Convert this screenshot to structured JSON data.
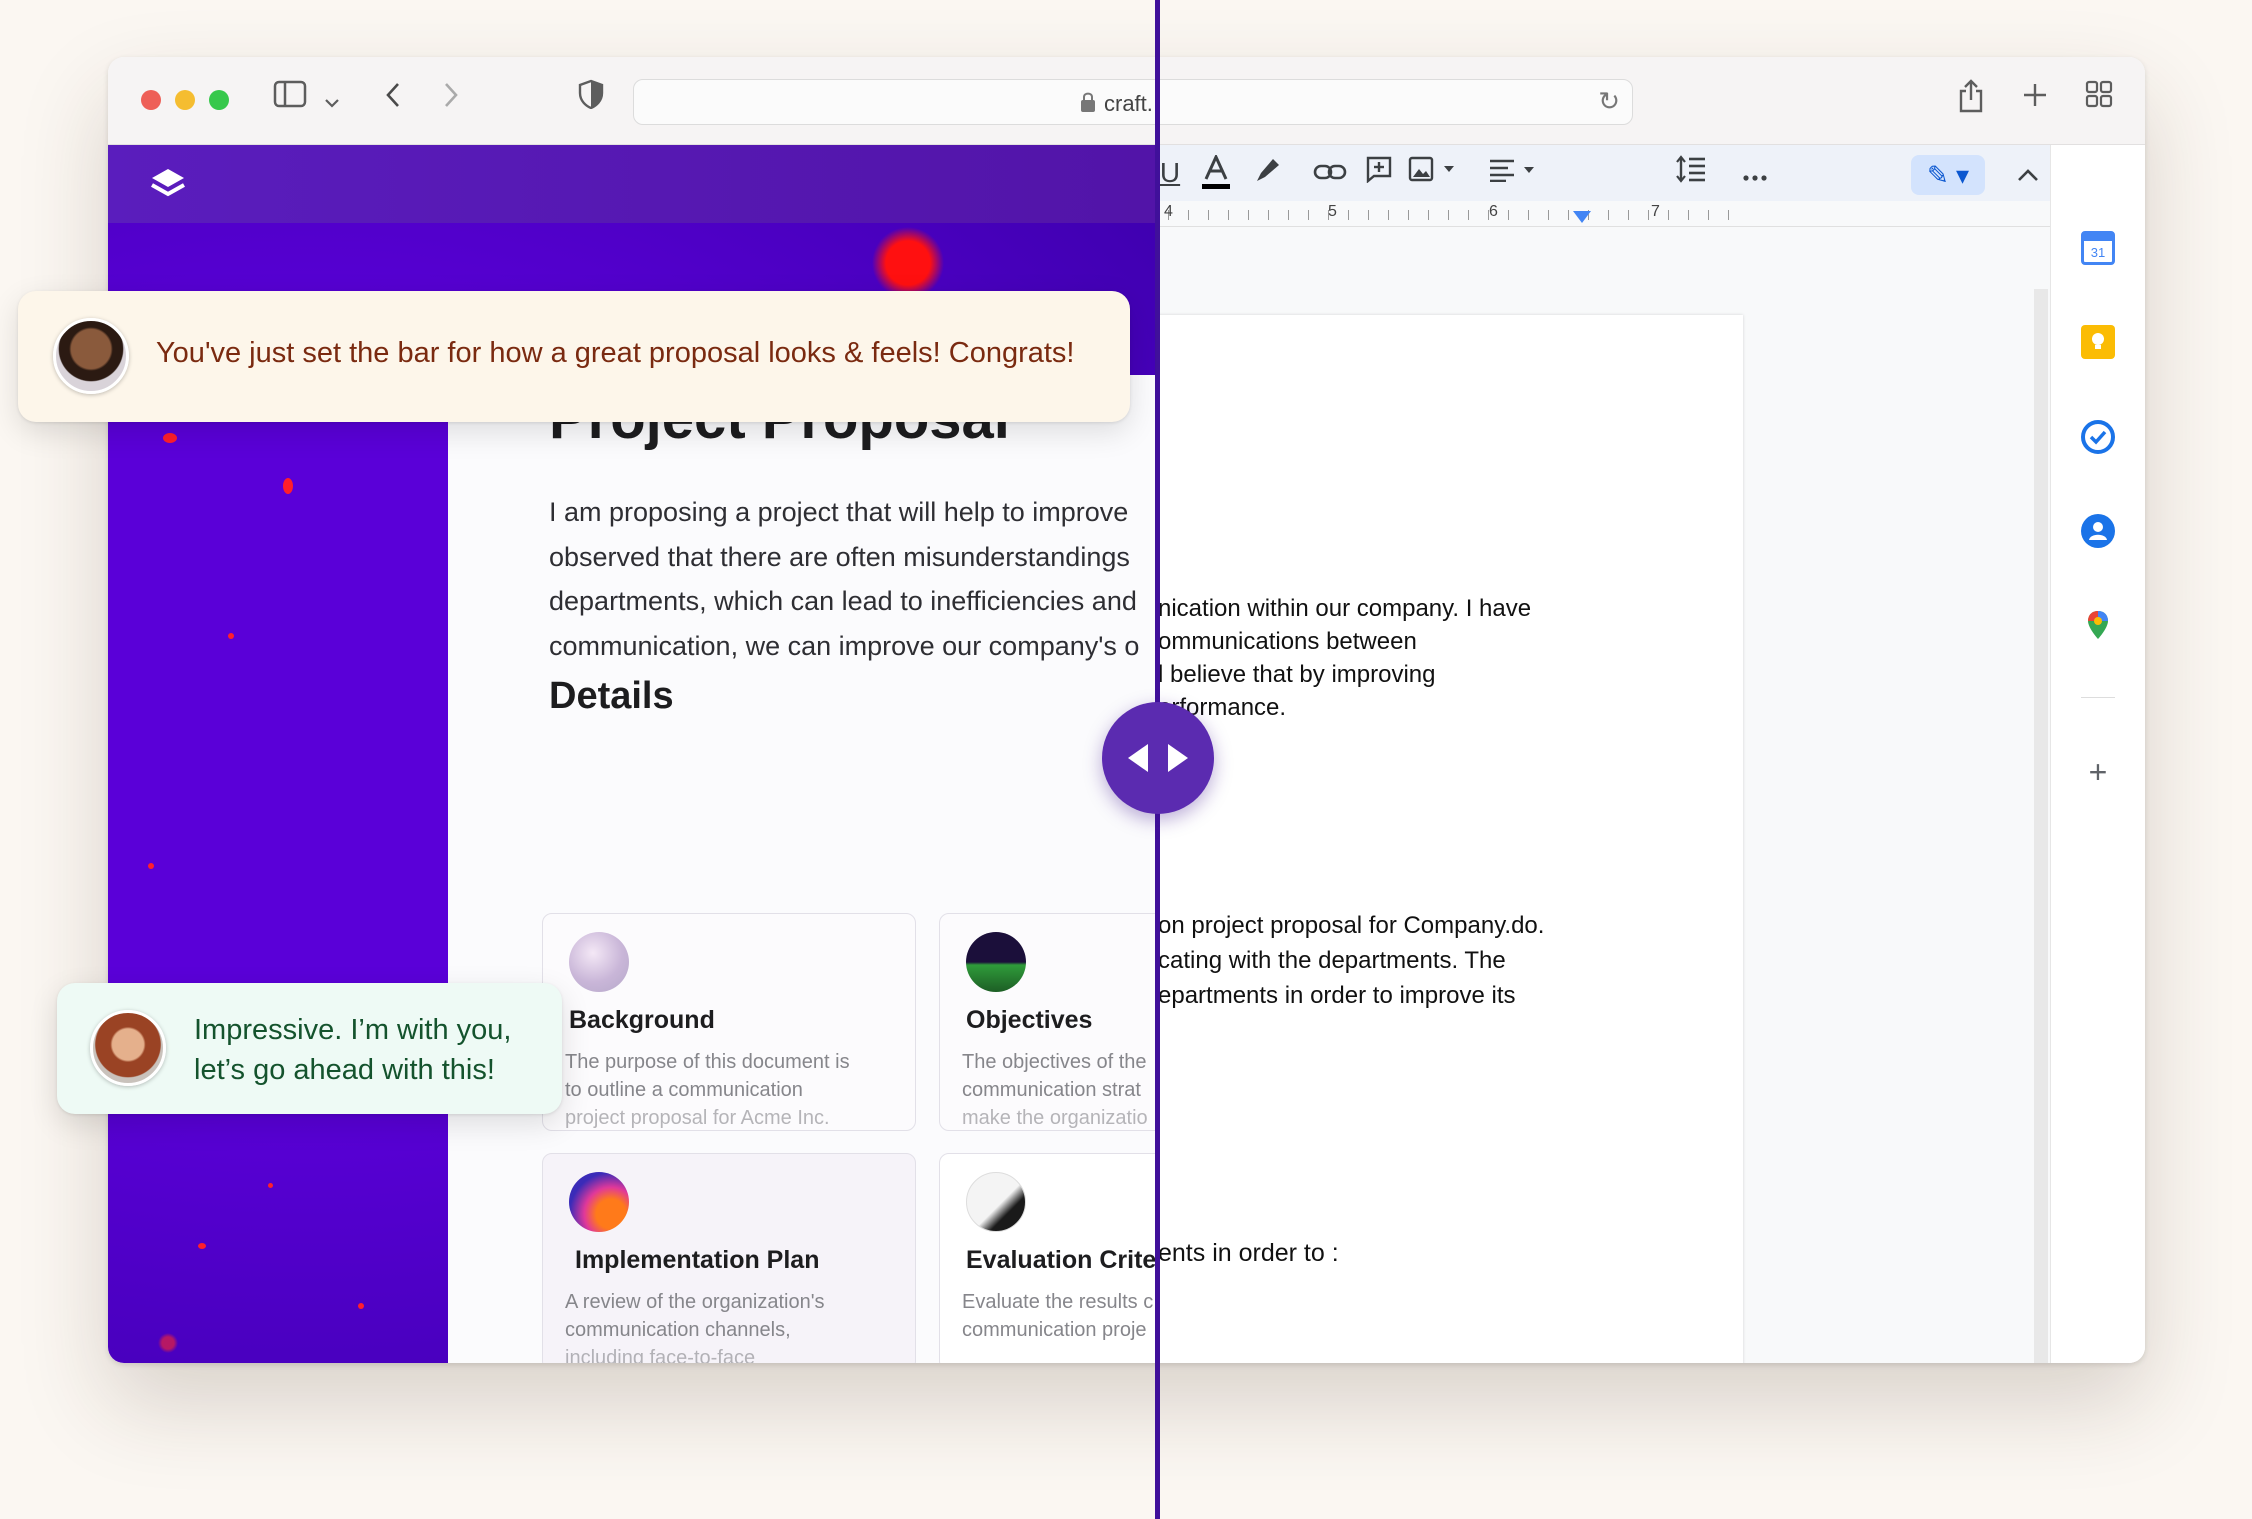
{
  "browser": {
    "url": "craft."
  },
  "craft": {
    "title": "Project Proposal",
    "intro_lines": [
      "I am proposing a project that will help to improve",
      "observed that there are often misunderstandings",
      "departments, which can lead to inefficiencies and",
      "communication, we can improve our company's o"
    ],
    "details_heading": "Details",
    "cards": [
      {
        "title": "Background",
        "desc": [
          "The purpose of this document is",
          "to outline a communication",
          "project proposal for Acme Inc."
        ]
      },
      {
        "title": "Objectives",
        "desc": [
          "The objectives of the",
          "communication strat",
          "make the organizatio"
        ]
      },
      {
        "title": "Implementation Plan",
        "desc": [
          "A review of the organization's",
          "communication channels,",
          "including face-to-face"
        ]
      },
      {
        "title": "Evaluation Criter",
        "desc": [
          "Evaluate the results c",
          "communication proje"
        ]
      }
    ]
  },
  "doc": {
    "ruler_numbers": [
      "4",
      "5",
      "6",
      "7"
    ],
    "para1": [
      "nication within our company. I have",
      "ommunications between",
      "l believe that by improving",
      "erformance."
    ],
    "para2": [
      "on project proposal for Company.do.",
      "cating with the departments. The",
      "epartments in order to improve its"
    ],
    "para3": "ents in order to :"
  },
  "comments": [
    {
      "text": "You've just set the bar for how a great proposal looks & feels! Congrats!"
    },
    {
      "lines": [
        "Impressive. I’m with you,",
        "let’s go ahead with this!"
      ]
    }
  ],
  "colors": {
    "accent_purple": "#5214a8",
    "divider": "#40109a",
    "handle": "#5b2bb0"
  },
  "icons": [
    "sidebar-icon",
    "chevron-down-icon",
    "back-icon",
    "forward-icon",
    "shield-icon",
    "lock-icon",
    "reload-icon",
    "share-icon",
    "new-tab-icon",
    "tab-overview-icon",
    "underline-icon",
    "text-color-icon",
    "highlight-icon",
    "link-icon",
    "comment-icon",
    "image-icon",
    "align-icon",
    "line-spacing-icon",
    "more-icon",
    "pen-icon",
    "collapse-icon",
    "calendar-icon",
    "keep-icon",
    "tasks-icon",
    "contacts-icon",
    "maps-icon",
    "add-icon"
  ]
}
